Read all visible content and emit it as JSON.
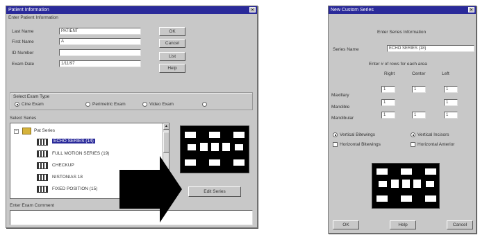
{
  "left_dialog": {
    "title": "Patient Information",
    "section_label": "Enter Patient Information",
    "last_name_label": "Last Name",
    "first_name_label": "First Name",
    "id_number_label": "ID Number",
    "exam_date_label": "Exam Date",
    "last_name_value": "PATIENT",
    "first_name_value": "A",
    "id_number_value": "",
    "exam_date_value": "1/11/97",
    "ok_label": "OK",
    "cancel_label": "Cancel",
    "list_label": "List",
    "help_label": "Help",
    "exam_type_label": "Select Exam Type",
    "exam_type_options": [
      "Cine Exam",
      "Perimetric Exam",
      "Video Exam",
      ""
    ],
    "select_series_label": "Select Series",
    "tree_root": "Pat Series",
    "tree_items": [
      "ECHO SERIES (14)",
      "FULL MOTION SERIES (19)",
      "CHECKUP",
      "NISTONIAS 18",
      "FIXED POSITION (15)"
    ],
    "edit_series_label": "Edit Series",
    "comment_label": "Enter Exam Comment",
    "comment_value": ""
  },
  "right_dialog": {
    "title": "New Custom Series",
    "section_label": "Enter Series Information",
    "series_name_label": "Series Name",
    "series_name_value": "ECHO SERIES (18)",
    "rows_label": "Enter # of rows for each area",
    "col_headers": [
      "Right",
      "Center",
      "Left"
    ],
    "row_labels": [
      "Maxillary",
      "Mandible",
      "Mandibular"
    ],
    "row_values": [
      [
        "1",
        "1",
        "1"
      ],
      [
        "1",
        "",
        "1"
      ],
      [
        "1",
        "1",
        "1"
      ]
    ],
    "options": [
      {
        "label": "Vertical Bitewings",
        "checked": true
      },
      {
        "label": "Vertical Incisors",
        "checked": true
      },
      {
        "label": "Horizontal Bitewings",
        "checked": false
      },
      {
        "label": "Horizontal Anterior",
        "checked": false
      }
    ],
    "ok_label": "OK",
    "help_label": "Help",
    "cancel_label": "Cancel"
  },
  "colors": {
    "dialog_bg": "#c8c8c8",
    "title_bar": "#2a2a9a",
    "arrow": "#000000"
  }
}
